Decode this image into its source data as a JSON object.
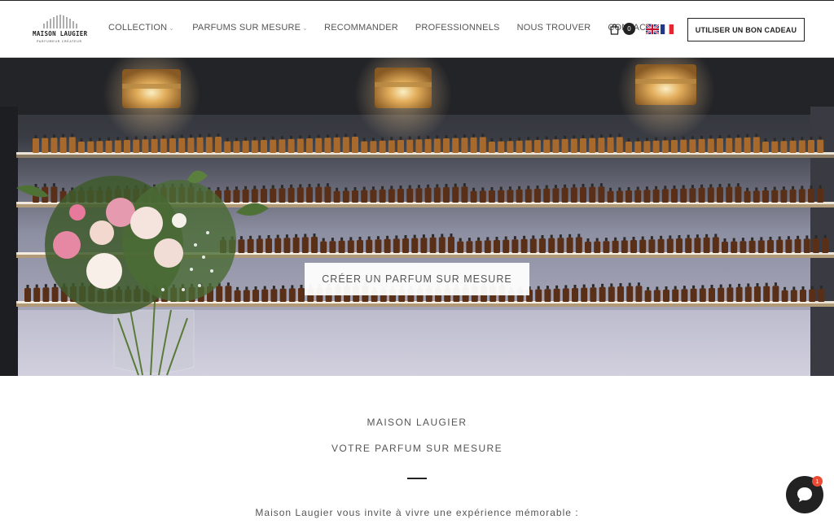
{
  "brand": {
    "logo_name": "MAISON LAUGIER",
    "logo_tagline": "PARFUMEUR CRÉATEUR"
  },
  "nav": {
    "items": [
      {
        "label": "COLLECTION",
        "has_dropdown": true
      },
      {
        "label": "PARFUMS SUR MESURE",
        "has_dropdown": true
      },
      {
        "label": "RECOMMANDER",
        "has_dropdown": false
      },
      {
        "label": "PROFESSIONNELS",
        "has_dropdown": false
      },
      {
        "label": "NOUS TROUVER",
        "has_dropdown": false
      },
      {
        "label": "CONTACT",
        "has_dropdown": false
      }
    ]
  },
  "cart": {
    "count": "0",
    "icon": "shopping-bag-icon"
  },
  "languages": [
    {
      "code": "en",
      "icon": "uk-flag-icon"
    },
    {
      "code": "fr",
      "icon": "french-flag-icon"
    }
  ],
  "gift_button": {
    "label": "UTILISER UN BON CADEAU"
  },
  "hero": {
    "cta_label": "CRÉER UN PARFUM SUR MESURE"
  },
  "content": {
    "title": "MAISON LAUGIER",
    "subtitle": "VOTRE PARFUM SUR MESURE",
    "intro": "Maison Laugier vous invite à vivre une expérience mémorable :"
  },
  "chat": {
    "badge_count": "1",
    "icon": "chat-bubble-icon"
  },
  "colors": {
    "accent_dark": "#222222",
    "text_gray": "#555555",
    "badge_red": "#e94b35"
  }
}
